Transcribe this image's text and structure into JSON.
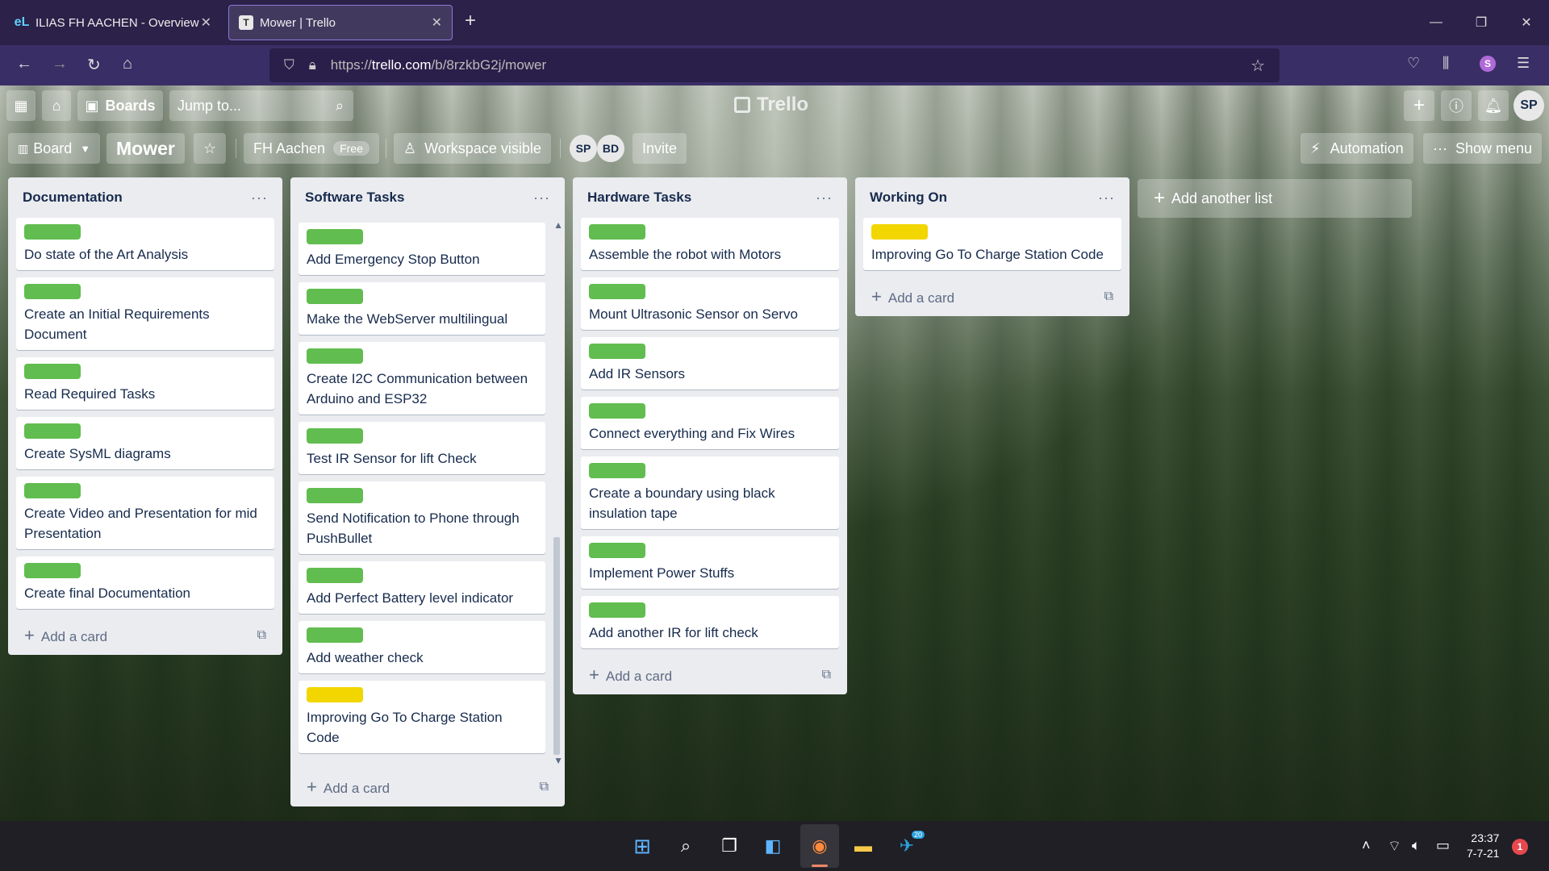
{
  "browser": {
    "tabs": [
      {
        "label": "ILIAS FH AACHEN - Overview",
        "favicon": "eL"
      },
      {
        "label": "Mower | Trello",
        "favicon": "T"
      }
    ],
    "url_prefix": "https://",
    "url_host": "trello.com",
    "url_path": "/b/8rzkbG2j/mower",
    "profile_initial": "S"
  },
  "trello_header": {
    "boards_label": "Boards",
    "jump_placeholder": "Jump to...",
    "logo_text": "Trello",
    "user_initials": "SP"
  },
  "board_header": {
    "view_label": "Board",
    "board_title": "Mower",
    "workspace_name": "FH Aachen",
    "workspace_plan": "Free",
    "visibility_label": "Workspace visible",
    "members": [
      "SP",
      "BD"
    ],
    "invite_label": "Invite",
    "automation_label": "Automation",
    "show_menu_label": "Show menu"
  },
  "lists": [
    {
      "title": "Documentation",
      "cards": [
        {
          "label": "green",
          "text": "Do state of the Art Analysis"
        },
        {
          "label": "green",
          "text": "Create an Initial Requirements Document"
        },
        {
          "label": "green",
          "text": "Read Required Tasks"
        },
        {
          "label": "green",
          "text": "Create SysML diagrams"
        },
        {
          "label": "green",
          "text": "Create Video and Presentation for mid Presentation"
        },
        {
          "label": "green",
          "text": "Create final Documentation"
        }
      ],
      "add_card": "Add a card"
    },
    {
      "title": "Software Tasks",
      "cards": [
        {
          "label": "green",
          "text": "Add Emergency Stop Button"
        },
        {
          "label": "green",
          "text": "Make the WebServer multilingual"
        },
        {
          "label": "green",
          "text": "Create I2C Communication between Arduino and ESP32"
        },
        {
          "label": "green",
          "text": "Test IR Sensor for lift Check"
        },
        {
          "label": "green",
          "text": "Send Notification to Phone through PushBullet"
        },
        {
          "label": "green",
          "text": "Add Perfect Battery level indicator"
        },
        {
          "label": "green",
          "text": "Add weather check"
        },
        {
          "label": "yellow",
          "text": "Improving Go To Charge Station Code"
        }
      ],
      "add_card": "Add a card"
    },
    {
      "title": "Hardware Tasks",
      "cards": [
        {
          "label": "green",
          "text": "Assemble the robot with Motors"
        },
        {
          "label": "green",
          "text": "Mount Ultrasonic Sensor on Servo"
        },
        {
          "label": "green",
          "text": "Add IR Sensors"
        },
        {
          "label": "green",
          "text": "Connect everything and Fix Wires"
        },
        {
          "label": "green",
          "text": "Create a boundary using black insulation tape"
        },
        {
          "label": "green",
          "text": "Implement Power Stuffs"
        },
        {
          "label": "green",
          "text": "Add another IR for lift check"
        }
      ],
      "add_card": "Add a card"
    },
    {
      "title": "Working On",
      "cards": [
        {
          "label": "yellow",
          "text": "Improving Go To Charge Station Code"
        }
      ],
      "add_card": "Add a card"
    }
  ],
  "add_list_label": "Add another list",
  "colors": {
    "label_green": "#61bd4f",
    "label_yellow": "#f2d600",
    "list_bg": "#ebecf0"
  },
  "taskbar": {
    "time": "23:37",
    "date": "7-7-21",
    "notification_count": "1",
    "telegram_badge": "20"
  }
}
